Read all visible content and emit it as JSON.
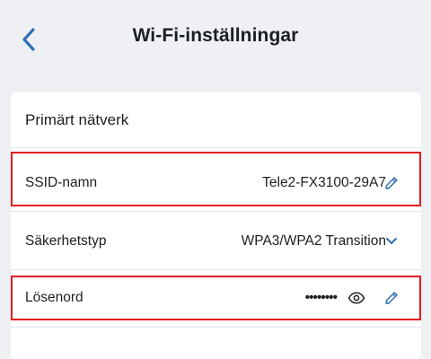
{
  "header": {
    "title": "Wi-Fi-inställningar",
    "back_icon": "chevron-left-icon"
  },
  "card": {
    "section_title": "Primärt nätverk",
    "rows": [
      {
        "label": "SSID-namn",
        "value": "Tele2-FX3100-29A7",
        "action_icon": "pencil-icon"
      },
      {
        "label": "Säkerhetstyp",
        "value": "WPA3/WPA2 Transition",
        "action_icon": "chevron-down-icon"
      },
      {
        "label": "Lösenord",
        "value": "••••••••",
        "reveal_icon": "eye-icon",
        "action_icon": "pencil-icon"
      }
    ]
  },
  "colors": {
    "accent": "#2f6fb3",
    "background": "#eef0f3",
    "highlight": "#e02020"
  }
}
